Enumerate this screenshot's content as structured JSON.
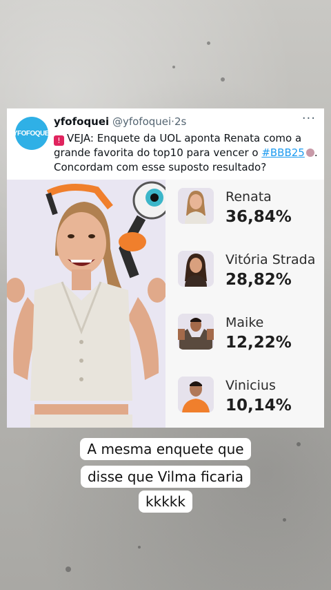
{
  "tweet": {
    "avatar_text": "YFOFOQUEI",
    "display_name": "yfofoquei",
    "handle": "@yfofoquei",
    "separator": "·",
    "time": "2s",
    "more_icon": "···",
    "text_before": "VEJA: Enquete da UOL aponta Renata como a grande favorita do top10 para vencer o ",
    "hashtag": "#BBB25",
    "text_after": ". Concordam com esse suposto resultado?"
  },
  "poll": {
    "results": [
      {
        "name": "Renata",
        "percent": "36,84%",
        "shirt_color": "#e8e4dc"
      },
      {
        "name": "Vitória Strada",
        "percent": "28,82%",
        "shirt_color": "#3a2a22"
      },
      {
        "name": "Maike",
        "percent": "12,22%",
        "shirt_color": "#5a4a3e"
      },
      {
        "name": "Vinicius",
        "percent": "10,14%",
        "shirt_color": "#f07f2c"
      }
    ]
  },
  "caption": {
    "lines": [
      "A mesma enquete que",
      "disse que Vilma ficaria",
      "kkkkk"
    ]
  },
  "colors": {
    "accent_blue": "#1d9bf0",
    "alert_red": "#e0245e",
    "mascot_orange": "#f07f2c"
  }
}
